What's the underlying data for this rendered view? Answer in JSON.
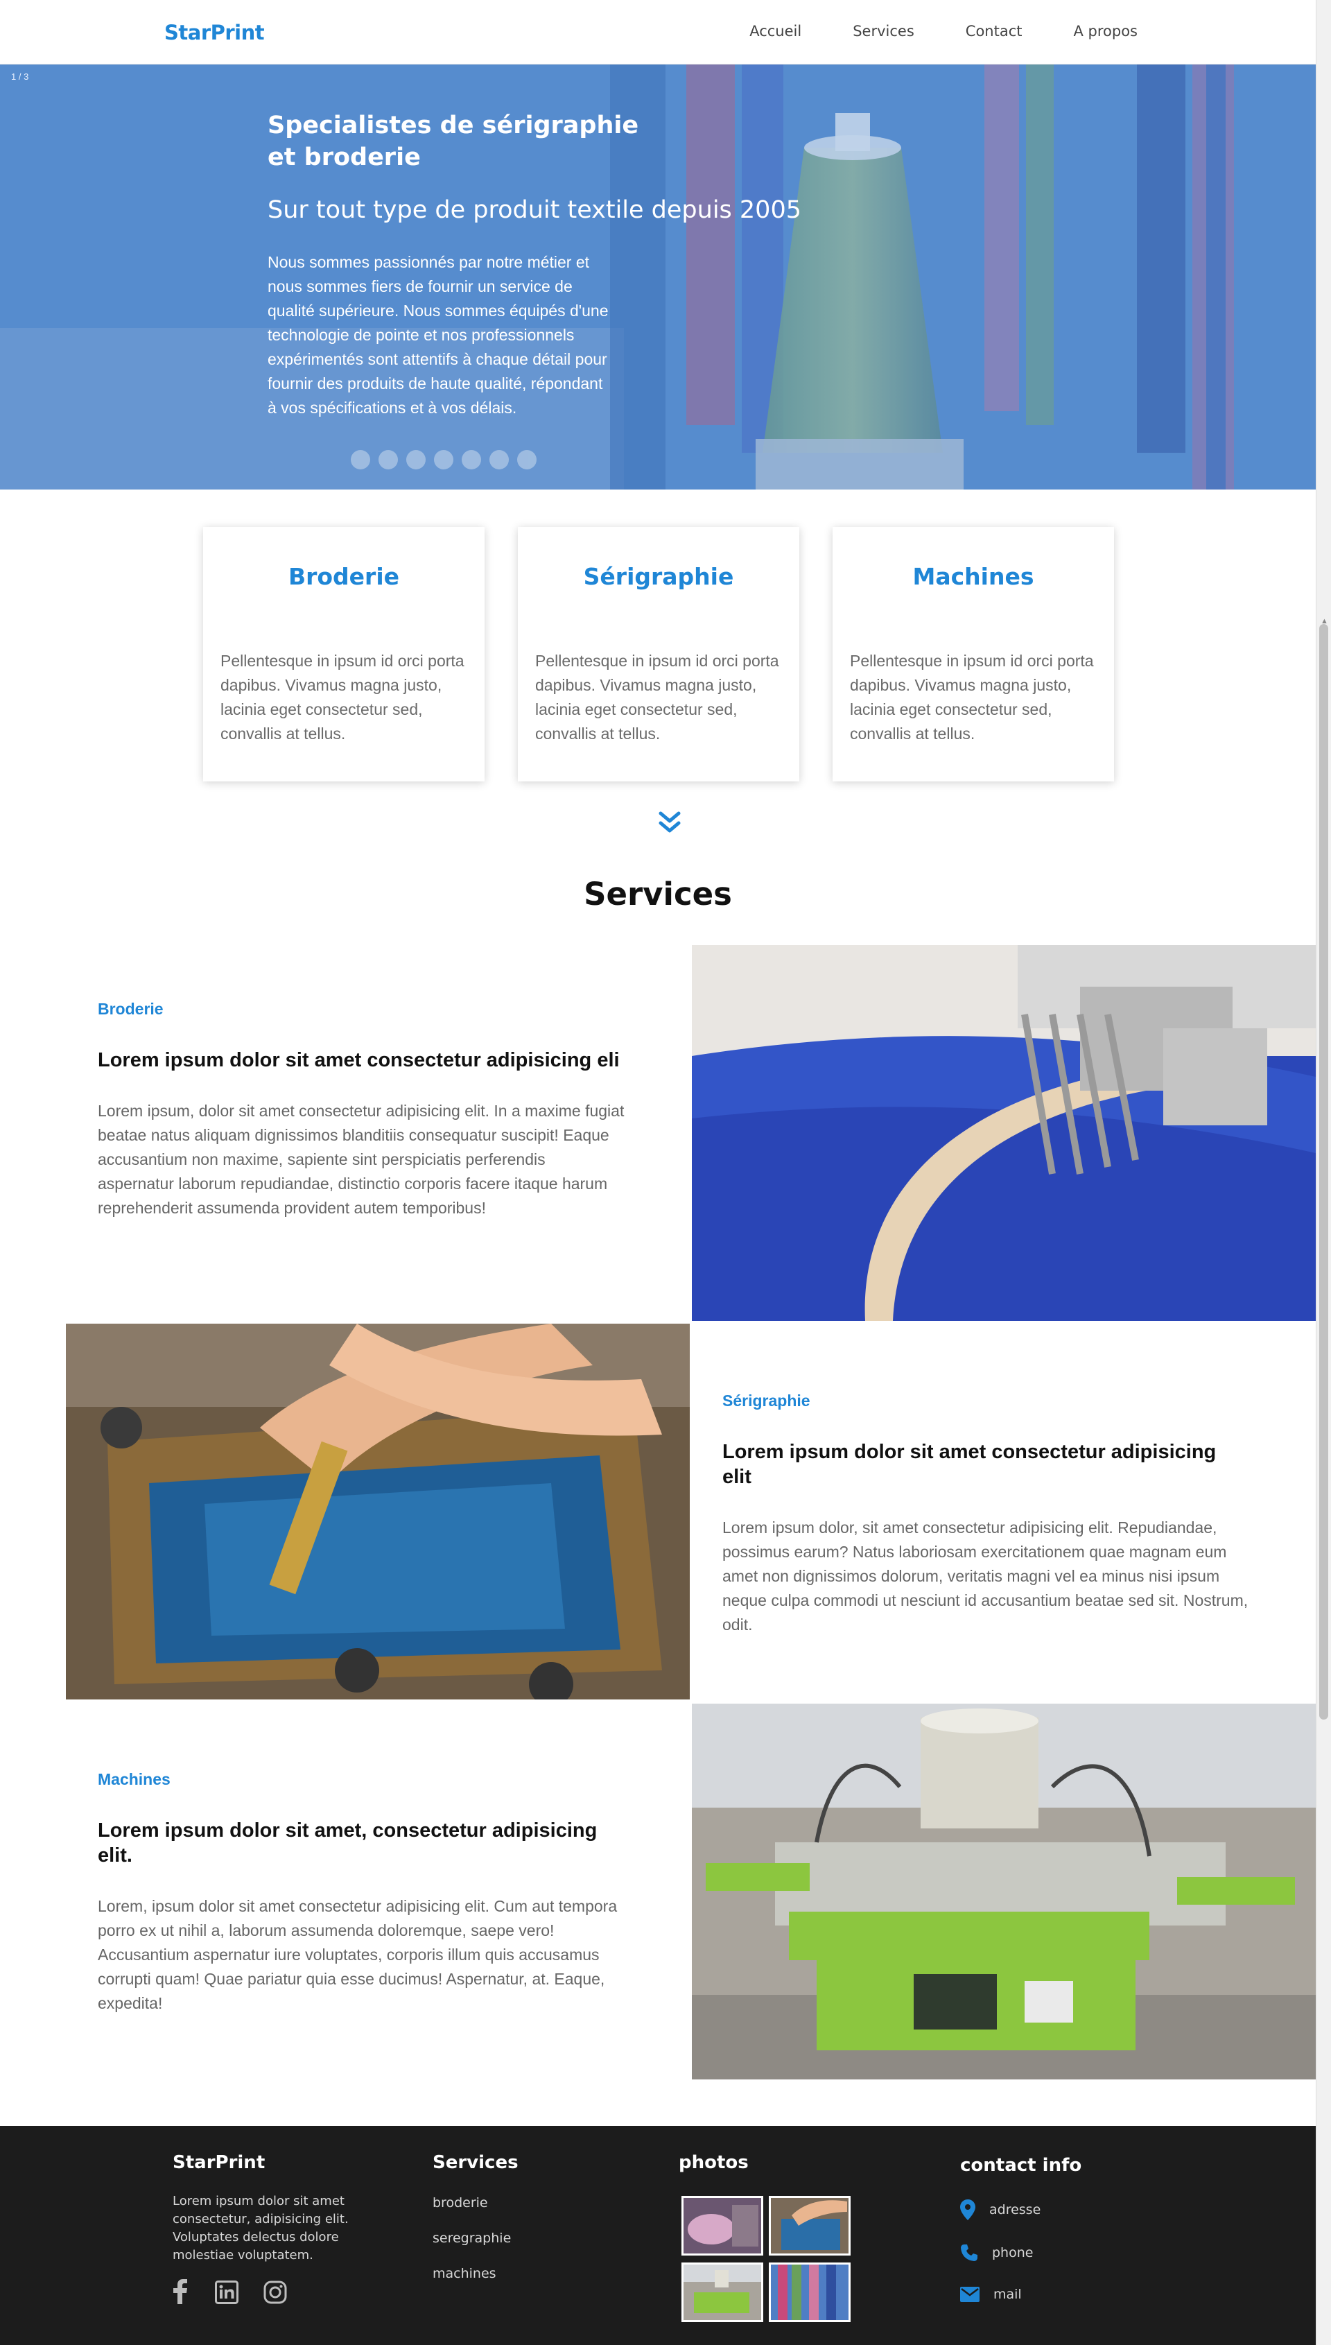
{
  "nav": {
    "brand": "StarPrint",
    "links": [
      "Accueil",
      "Services",
      "Contact",
      "A propos"
    ]
  },
  "hero": {
    "slide_counter": "1 / 3",
    "title": "Specialistes de sérigraphie et broderie",
    "subtitle": "Sur tout type de produit textile depuis 2005",
    "paragraph": "Nous sommes passionnés par notre métier et nous sommes fiers de fournir un service de qualité supérieure. Nous sommes équipés d'une technologie de pointe et nos professionnels expérimentés sont attentifs à chaque détail pour fournir des produits de haute qualité, répondant à vos spécifications et à vos délais."
  },
  "cards": [
    {
      "title": "Broderie",
      "text": "Pellentesque in ipsum id orci porta dapibus. Vivamus magna justo, lacinia eget consectetur sed, convallis at tellus."
    },
    {
      "title": "Sérigraphie",
      "text": "Pellentesque in ipsum id orci porta dapibus. Vivamus magna justo, lacinia eget consectetur sed, convallis at tellus."
    },
    {
      "title": "Machines",
      "text": "Pellentesque in ipsum id orci porta dapibus. Vivamus magna justo, lacinia eget consectetur sed, convallis at tellus."
    }
  ],
  "services": {
    "title": "Services",
    "items": [
      {
        "kicker": "Broderie",
        "heading": "Lorem ipsum dolor sit amet consectetur adipisicing eli",
        "text": "Lorem ipsum, dolor sit amet consectetur adipisicing elit. In a maxime fugiat beatae natus aliquam dignissimos blanditiis consequatur suscipit! Eaque accusantium non maxime, sapiente sint perspiciatis perferendis aspernatur laborum repudiandae, distinctio corporis facere itaque harum reprehenderit assumenda provident autem temporibus!"
      },
      {
        "kicker": "Sérigraphie",
        "heading": "Lorem ipsum dolor sit amet consectetur adipisicing elit",
        "text": "Lorem ipsum dolor, sit amet consectetur adipisicing elit. Repudiandae, possimus earum? Natus laboriosam exercitationem quae magnam eum amet non dignissimos dolorum, veritatis magni vel ea minus nisi ipsum neque culpa commodi ut nesciunt id accusantium beatae sed sit. Nostrum, odit."
      },
      {
        "kicker": "Machines",
        "heading": "Lorem ipsum dolor sit amet, consectetur adipisicing elit.",
        "text": "Lorem, ipsum dolor sit amet consectetur adipisicing elit. Cum aut tempora porro ex ut nihil a, laborum assumenda doloremque, saepe vero! Accusantium aspernatur iure voluptates, corporis illum quis accusamus corrupti quam! Quae pariatur quia esse ducimus! Aspernatur, at. Eaque, expedita!"
      }
    ]
  },
  "footer": {
    "brand": "StarPrint",
    "about": "Lorem ipsum dolor sit amet consectetur, adipisicing elit. Voluptates delectus dolore molestiae voluptatem.",
    "services_title": "Services",
    "services_links": [
      "broderie",
      "seregraphie",
      "machines"
    ],
    "photos_title": "photos",
    "contact_title": "contact info",
    "contact": [
      "adresse",
      "phone",
      "mail"
    ]
  },
  "colors": {
    "accent": "#1f86d6",
    "footer_bg": "#1c1c1c"
  }
}
